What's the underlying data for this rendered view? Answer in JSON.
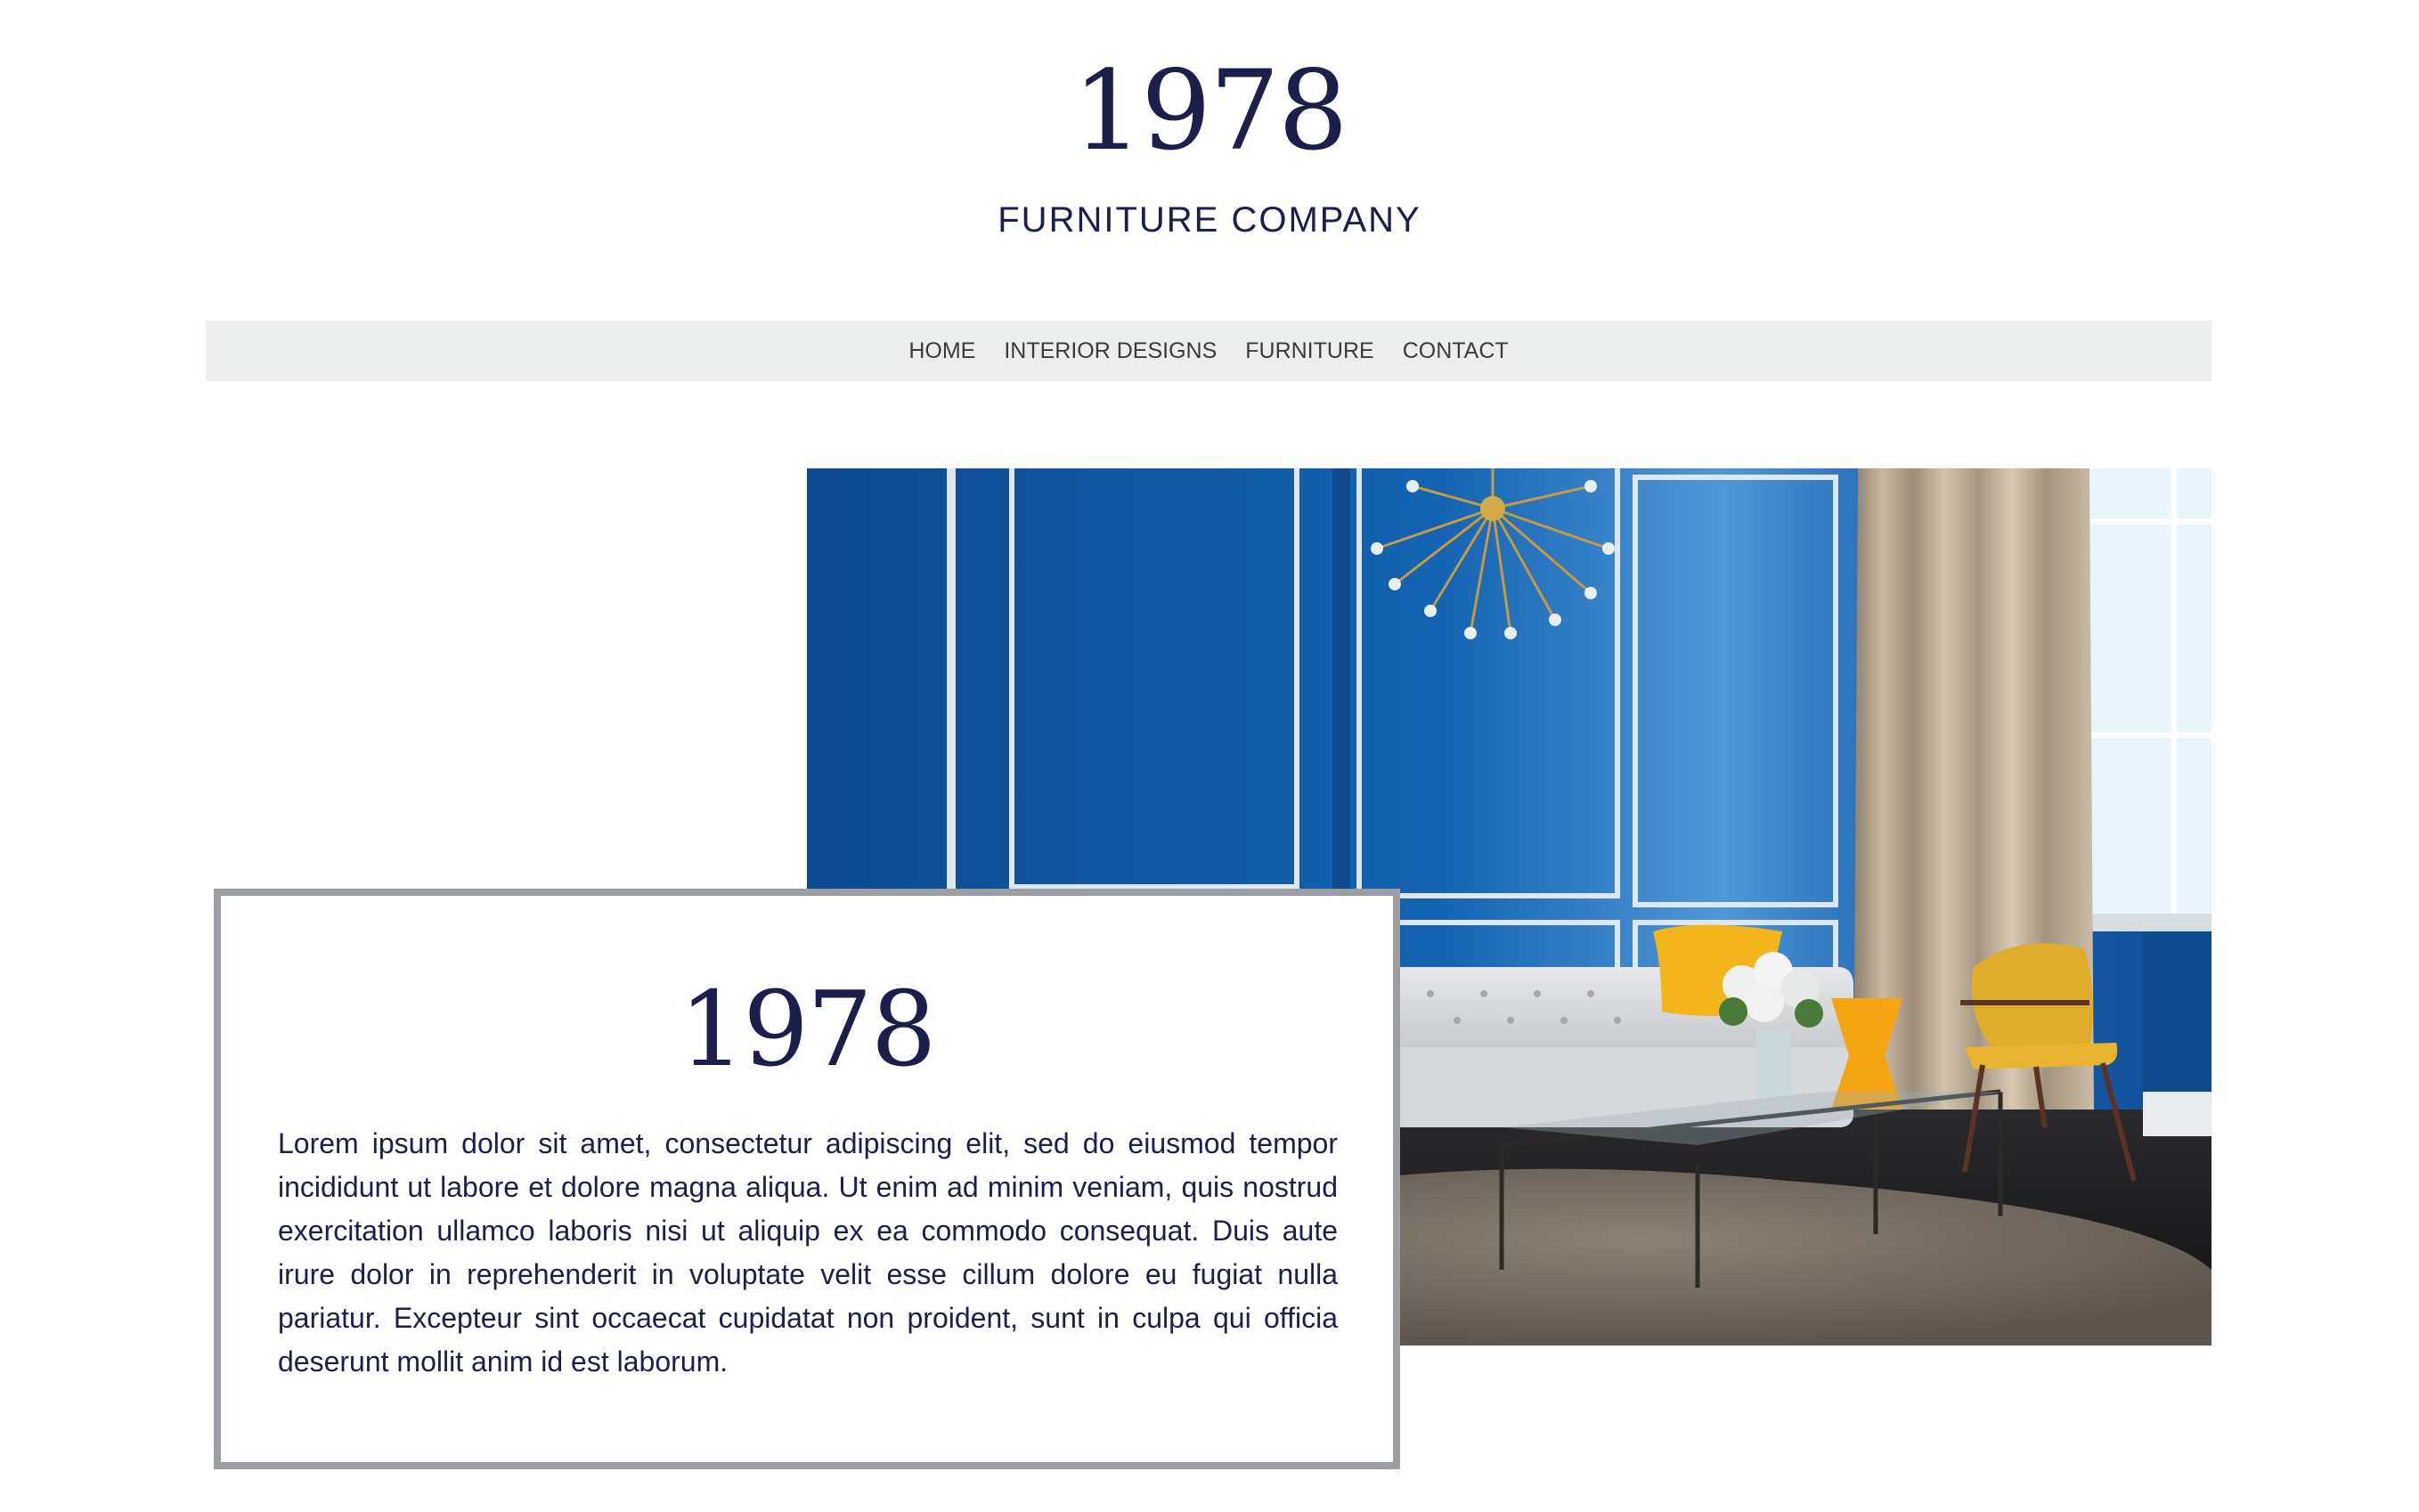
{
  "brand": {
    "year": "1978",
    "subtitle": "FURNITURE COMPANY"
  },
  "nav": {
    "items": [
      {
        "label": "HOME"
      },
      {
        "label": "INTERIOR DESIGNS"
      },
      {
        "label": "FURNITURE"
      },
      {
        "label": "CONTACT"
      }
    ]
  },
  "hero_image": {
    "subject": "living room interior with blue paneled walls, white tufted sofa, yellow chair, glass coffee table, sputnik chandelier"
  },
  "card": {
    "title": "1978",
    "body": "Lorem ipsum dolor sit amet, consectetur adipiscing elit, sed do eiusmod tempor incididunt ut labore et dolore magna aliqua. Ut enim ad minim veniam, quis nostrud exercitation ullamco laboris nisi ut aliquip ex ea commodo consequat. Duis aute irure dolor in reprehenderit in voluptate velit esse cillum dolore eu fugiat nulla pariatur. Excepteur sint occaecat cupidatat non proident, sunt in culpa qui officia deserunt mollit anim id est laborum."
  },
  "colors": {
    "brand_navy": "#1c1e4b",
    "nav_background": "#eceeed",
    "card_border": "#9b9ea2",
    "wall_blue": "#1560ad",
    "accent_yellow": "#f2b51c"
  }
}
